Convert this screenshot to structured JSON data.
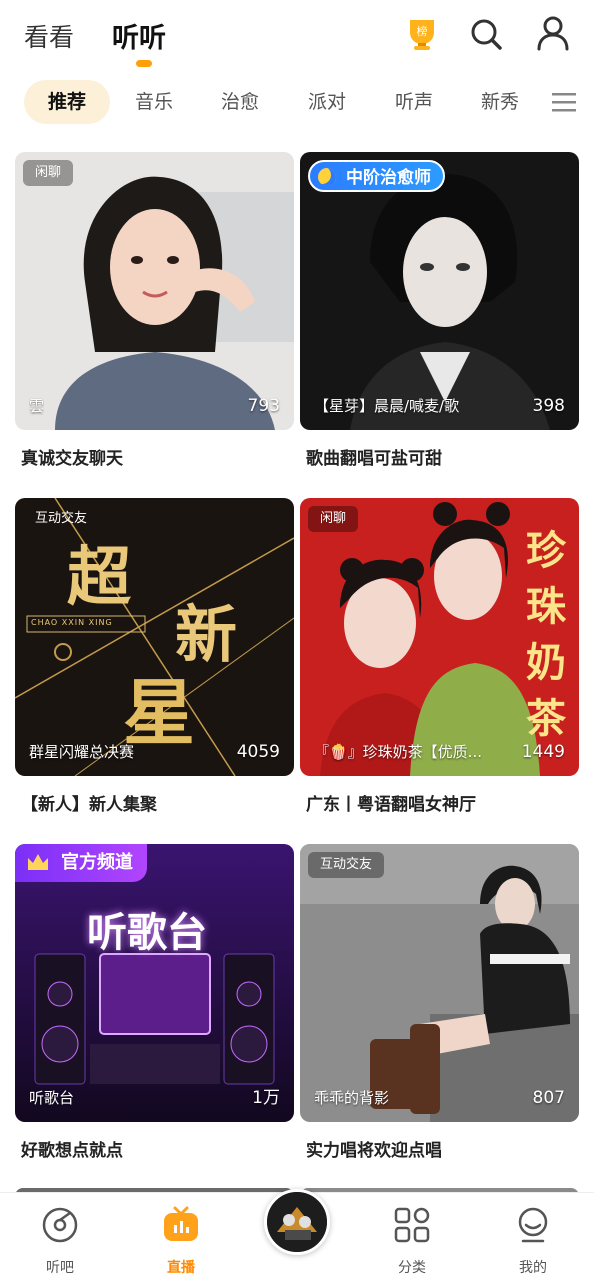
{
  "header": {
    "tabs": [
      "看看",
      "听听"
    ],
    "active_tab": "听听",
    "rank_label": "榜",
    "icons": [
      "rank-icon",
      "search-icon",
      "user-icon"
    ]
  },
  "categories": {
    "items": [
      "推荐",
      "音乐",
      "治愈",
      "派对",
      "听声",
      "新秀"
    ],
    "active": "推荐",
    "menu_icon": "menu-icon"
  },
  "cards": [
    {
      "badge": "闲聊",
      "host": "雲",
      "count": "793",
      "title": "真诚交友聊天"
    },
    {
      "badge": "中阶治愈师",
      "host": "【星芽】晨晨/喊麦/歌",
      "count": "398",
      "title": "歌曲翻唱可盐可甜"
    },
    {
      "badge": "互动交友",
      "host": "群星闪耀总决赛",
      "count": "4059",
      "title": "【新人】新人集聚",
      "art_big_1": "超",
      "art_big_2": "新",
      "art_big_3": "星",
      "art_small": "CHAO XXIN XING"
    },
    {
      "badge": "闲聊",
      "host": "『🍿』珍珠奶茶【优质...",
      "count": "1449",
      "title": "广东丨粤语翻唱女神厅",
      "art_text": [
        "珍",
        "珠",
        "奶",
        "茶"
      ]
    },
    {
      "badge": "官方频道",
      "host": "听歌台",
      "count": "1万",
      "title": "好歌想点就点",
      "art_text": "听歌台"
    },
    {
      "badge": "互动交友",
      "host": "乖乖的背影",
      "count": "807",
      "title": "实力唱将欢迎点唱"
    }
  ],
  "bottom_nav": {
    "items": [
      {
        "label": "听吧",
        "icon": "disc-icon"
      },
      {
        "label": "直播",
        "icon": "live-tv-icon"
      },
      {
        "label": "",
        "icon": "center-music-disc"
      },
      {
        "label": "分类",
        "icon": "grid-icon"
      },
      {
        "label": "我的",
        "icon": "profile-icon"
      }
    ],
    "active": "直播"
  },
  "colors": {
    "accent": "#ff9f0a",
    "active_pill_bg": "#fdf0d9"
  }
}
